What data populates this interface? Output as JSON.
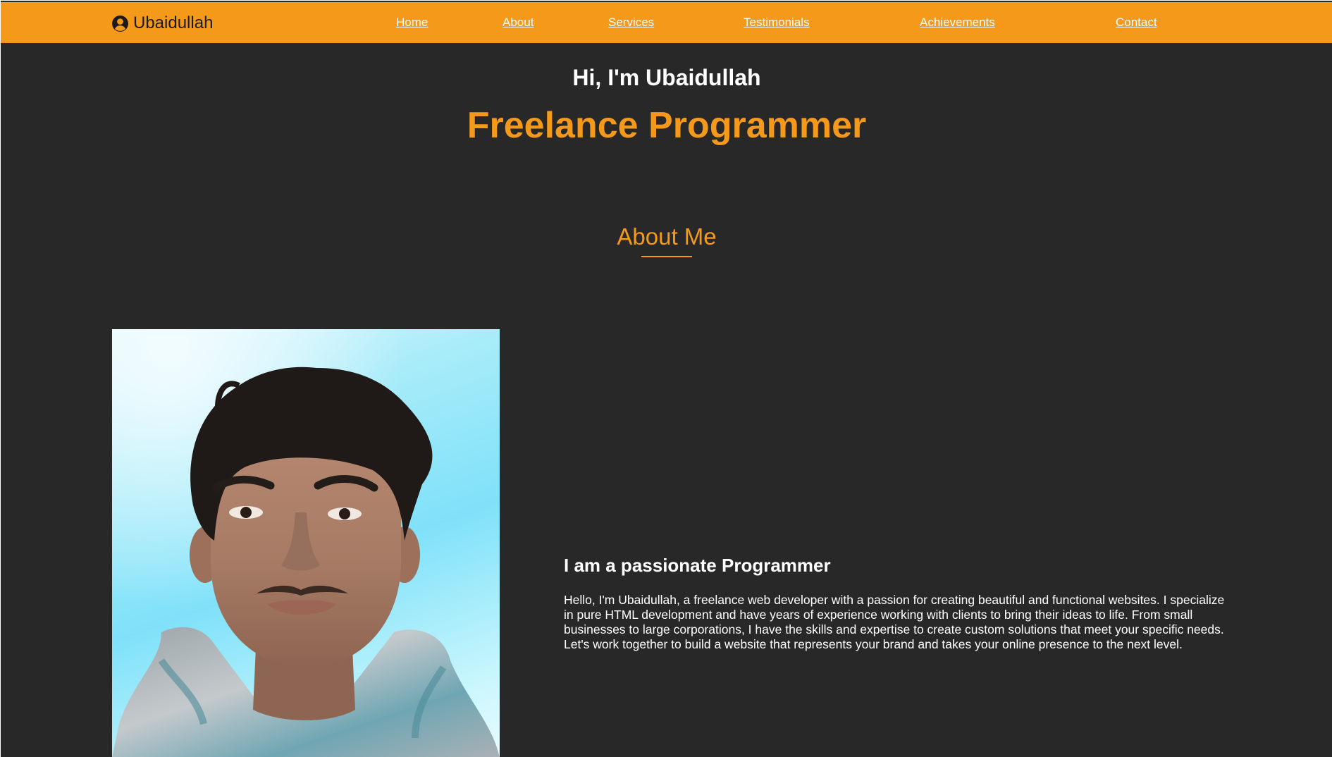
{
  "navbar": {
    "brand_name": "Ubaidullah",
    "brand_icon": "user-circle-icon",
    "links": [
      {
        "label": "Home"
      },
      {
        "label": "About"
      },
      {
        "label": "Services"
      },
      {
        "label": "Testimonials"
      },
      {
        "label": "Achievements"
      },
      {
        "label": "Contact"
      }
    ]
  },
  "hero": {
    "greeting": "Hi, I'm Ubaidullah",
    "role": "Freelance Programmer"
  },
  "about": {
    "heading": "About Me",
    "subtitle": "I am a passionate Programmer",
    "text": "Hello, I'm Ubaidullah, a freelance web developer with a passion for creating beautiful and functional websites. I specialize in pure HTML development and have years of experience working with clients to bring their ideas to life. From small businesses to large corporations, I have the skills and expertise to create custom solutions that meet your specific needs. Let's work together to build a website that represents your brand and takes your online presence to the next level."
  },
  "colors": {
    "accent": "#f4991a",
    "background": "#282828",
    "text": "#ffffff"
  }
}
